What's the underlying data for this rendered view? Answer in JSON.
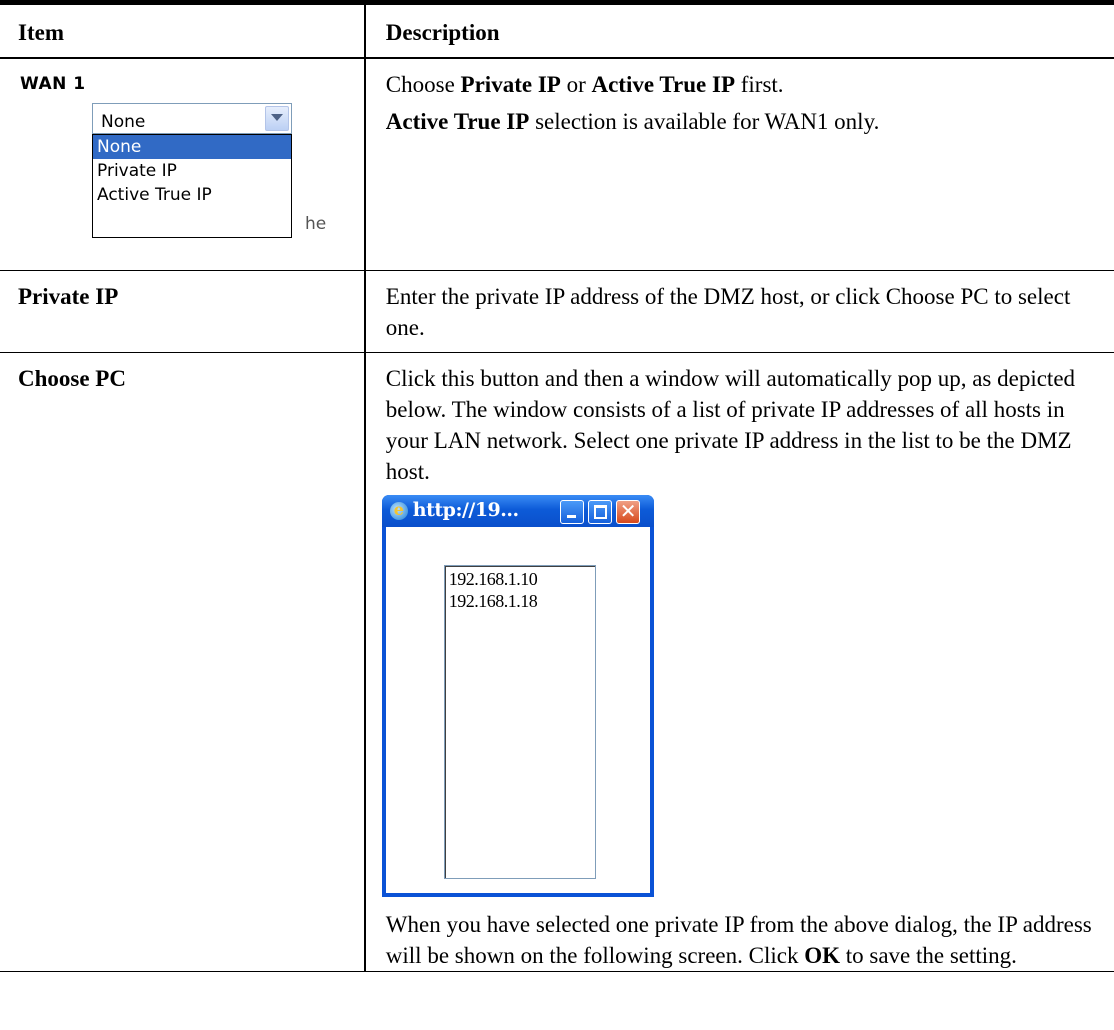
{
  "header": {
    "item": "Item",
    "description": "Description"
  },
  "wan1": {
    "title": "WAN 1",
    "selected": "None",
    "options": [
      "None",
      "Private IP",
      "Active True IP"
    ],
    "ghost_text": "he",
    "desc_line1": {
      "pre": "Choose ",
      "b1": "Private IP",
      "mid": " or ",
      "b2": "Active True IP",
      "post": " first."
    },
    "desc_line2": {
      "b1": "Active True IP",
      "post": " selection is available for WAN1 only."
    }
  },
  "private_ip": {
    "label": "Private IP",
    "desc": "Enter the private IP address of the DMZ host, or click Choose PC to select one."
  },
  "choose_pc": {
    "label": "Choose PC",
    "desc": "Click this button and then a window will automatically pop up, as depicted below. The window consists of a list of private IP addresses of all hosts in your LAN network. Select one private IP address in the list to be the DMZ host.",
    "popup": {
      "title": "http://19...",
      "ips": [
        "192.168.1.10",
        "192.168.1.18"
      ]
    },
    "after": {
      "pre": "When you have selected one private IP from the above dialog, the IP address will be shown on the following screen. Click ",
      "b": "OK",
      "post": " to save the setting."
    }
  }
}
